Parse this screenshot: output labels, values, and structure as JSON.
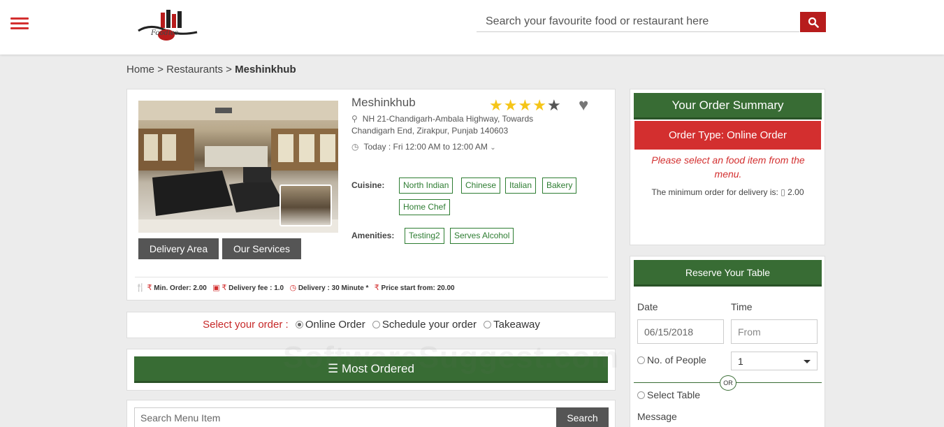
{
  "header": {
    "logo_text": "Foodies",
    "search_placeholder": "Search your favourite food or restaurant here"
  },
  "breadcrumb": {
    "home": "Home",
    "sep1": ">",
    "restaurants": "Restaurants",
    "sep2": ">",
    "current": "Meshinkhub"
  },
  "restaurant": {
    "name": "Meshinkhub",
    "address": "NH 21-Chandigarh-Ambala Highway, Towards Chandigarh End, Zirakpur, Punjab 140603",
    "hours": "Today : Fri 12:00 AM to 12:00 AM",
    "rating": 4,
    "rating_max": 5,
    "delivery_area_label": "Delivery Area",
    "our_services_label": "Our Services",
    "cuisine_label": "Cuisine:",
    "cuisines": [
      "North Indian",
      "Chinese",
      "Italian",
      "Bakery",
      "Home Chef"
    ],
    "amenities_label": "Amenities:",
    "amenities": [
      "Testing2",
      "Serves Alcohol"
    ],
    "min_order": "Min. Order:  2.00",
    "delivery_fee": "Delivery fee : 1.0",
    "delivery_time": "Delivery : 30 Minute *",
    "price_start": "Price start from: 20.00"
  },
  "order_type": {
    "label": "Select your order :",
    "options": [
      "Online Order",
      "Schedule your order",
      "Takeaway"
    ],
    "selected": "Online Order"
  },
  "most_ordered": {
    "title": "Most Ordered"
  },
  "menu_search": {
    "placeholder": "Search Menu Item",
    "button": "Search"
  },
  "order_summary": {
    "title": "Your Order Summary",
    "order_type": "Order Type: Online Order",
    "message": "Please select an food item from the menu.",
    "min_delivery": "The minimum order for delivery is:",
    "min_value": "2.00"
  },
  "reserve": {
    "title": "Reserve Your Table",
    "date_label": "Date",
    "date_value": "06/15/2018",
    "time_label": "Time",
    "time_placeholder": "From",
    "people_label": "No. of People",
    "people_value": "1",
    "or_label": "OR",
    "table_label": "Select Table",
    "message_label": "Message"
  },
  "watermark": "SoftwareSuggest.com",
  "colors": {
    "brand_red": "#d32f2f",
    "brand_green": "#386c34",
    "star": "#f5c518"
  }
}
